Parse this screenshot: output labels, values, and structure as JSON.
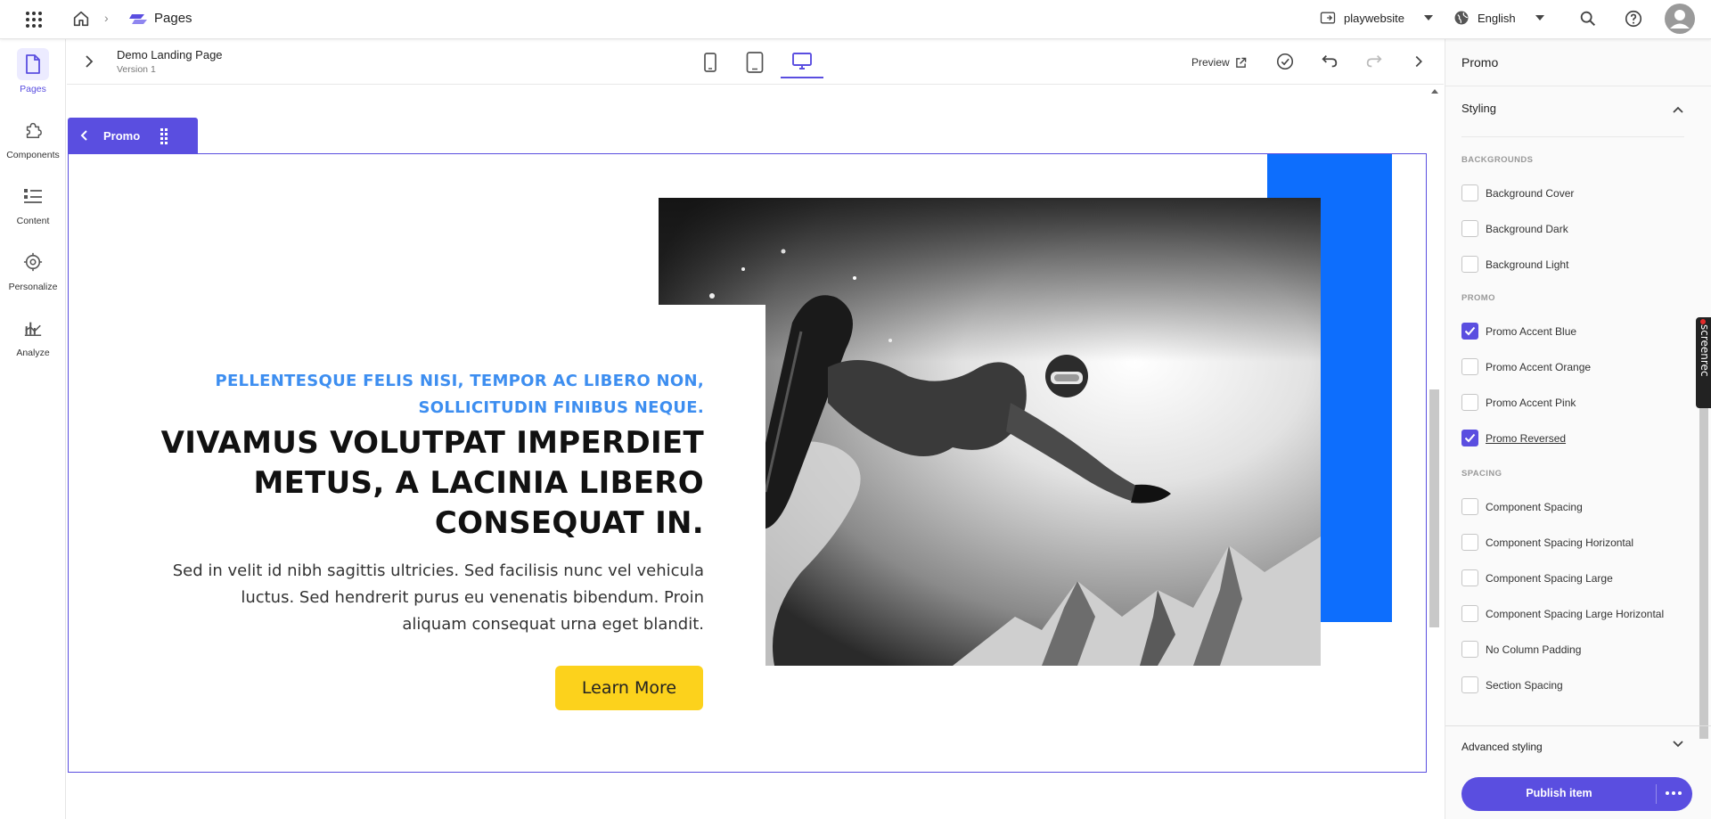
{
  "topbar": {
    "breadcrumb_section": "Pages",
    "site_selector": "playwebsite",
    "language_selector": "English",
    "icons": [
      "app-grid-icon",
      "home-icon",
      "chevron-right-icon",
      "pages-logo-icon",
      "site-icon",
      "globe-icon",
      "search-icon",
      "help-icon",
      "user-avatar-icon"
    ]
  },
  "leftrail": {
    "items": [
      {
        "label": "Pages",
        "icon": "page-icon",
        "active": true
      },
      {
        "label": "Components",
        "icon": "puzzle-icon",
        "active": false
      },
      {
        "label": "Content",
        "icon": "content-list-icon",
        "active": false
      },
      {
        "label": "Personalize",
        "icon": "target-icon",
        "active": false
      },
      {
        "label": "Analyze",
        "icon": "analyze-chart-icon",
        "active": false
      }
    ]
  },
  "editor": {
    "title": "Demo Landing Page",
    "version": "Version 1",
    "devices": [
      "mobile-device-icon",
      "tablet-device-icon",
      "desktop-device-icon"
    ],
    "active_device": "desktop",
    "preview_label": "Preview"
  },
  "component": {
    "tag_label": "Promo",
    "eyebrow_line1": "PELLENTESQUE FELIS NISI, TEMPOR AC LIBERO NON,",
    "eyebrow_line2": "SOLLICITUDIN FINIBUS NEQUE.",
    "headline_line1": "VIVAMUS VOLUTPAT IMPERDIET",
    "headline_line2": "METUS, A LACINIA LIBERO",
    "headline_line3": "CONSEQUAT IN.",
    "body_line1": "Sed in velit id nibh sagittis ultricies. Sed facilisis nunc vel vehicula",
    "body_line2": "luctus. Sed hendrerit purus eu venenatis bibendum. Proin",
    "body_line3": "aliquam consequat urna eget blandit.",
    "cta_label": "Learn More",
    "accent_color": "#0d6efd",
    "cta_color": "#fcd21c"
  },
  "panel": {
    "title": "Promo",
    "styling_header": "Styling",
    "sections": [
      {
        "label": "BACKGROUNDS",
        "options": [
          {
            "label": "Background Cover",
            "checked": false
          },
          {
            "label": "Background Dark",
            "checked": false
          },
          {
            "label": "Background Light",
            "checked": false
          }
        ]
      },
      {
        "label": "PROMO",
        "options": [
          {
            "label": "Promo Accent Blue",
            "checked": true
          },
          {
            "label": "Promo Accent Orange",
            "checked": false
          },
          {
            "label": "Promo Accent Pink",
            "checked": false
          },
          {
            "label": "Promo Reversed",
            "checked": true
          }
        ]
      },
      {
        "label": "SPACING",
        "options": [
          {
            "label": "Component Spacing",
            "checked": false
          },
          {
            "label": "Component Spacing Horizontal",
            "checked": false
          },
          {
            "label": "Component Spacing Large",
            "checked": false
          },
          {
            "label": "Component Spacing Large Horizontal",
            "checked": false
          },
          {
            "label": "No Column Padding",
            "checked": false
          },
          {
            "label": "Section Spacing",
            "checked": false
          }
        ]
      }
    ],
    "advanced_label": "Advanced styling",
    "publish_label": "Publish item",
    "brand_color": "#5a4ee0"
  },
  "overlay": {
    "screenrec_label": "screenrec"
  }
}
